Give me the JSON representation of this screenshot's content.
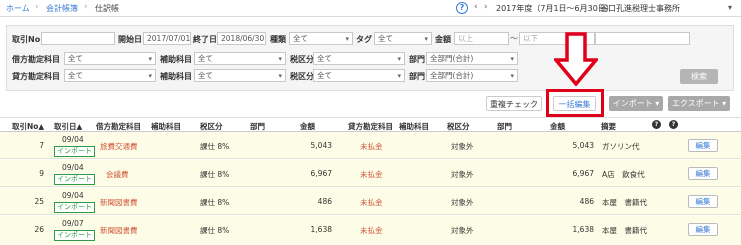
{
  "nav": {
    "home": "ホーム",
    "crumb1": "会計帳簿",
    "crumb2": "仕訳帳",
    "fiscal_year": "2017年度（7月1日〜6月30日）",
    "office": "谷口孔進税理士事務所"
  },
  "filters": {
    "id_label": "取引No",
    "start_label": "開始日",
    "start_value": "2017/07/01",
    "end_label": "終了日",
    "end_value": "2018/06/30",
    "type_label": "種類",
    "type_value": "全て",
    "tag_label": "タグ",
    "tag_value": "全て",
    "amount_label": "金額",
    "amount_min_ph": "以上",
    "amount_max_ph": "以下",
    "tilde": "〜",
    "debit_label": "借方勘定科目",
    "debit_value": "全て",
    "sub_label": "補助科目",
    "sub_value": "全て",
    "tax_label": "税区分",
    "tax_value": "全て",
    "dept_label": "部門",
    "dept_value": "全部門(合計)",
    "credit_label": "貸方勘定科目",
    "credit_value": "全て",
    "sub2_value": "全て",
    "tax2_value": "全て",
    "dept2_value": "全部門(合計)",
    "search": "検索"
  },
  "actions": {
    "dup_check": "重複チェック",
    "bulk_edit": "一括編集",
    "import": "インポート ▾",
    "export": "エクスポート ▾"
  },
  "table": {
    "headers": {
      "id": "取引No▲",
      "date": "取引日▲",
      "debit": "借方勘定科目",
      "sub": "補助科目",
      "tax": "税区分",
      "dept": "部門",
      "amount": "金額",
      "credit": "貸方勘定科目",
      "sub2": "補助科目",
      "tax2": "税区分",
      "dept2": "部門",
      "amount2": "金額",
      "memo": "摘要",
      "q": "?"
    },
    "rows": [
      {
        "id": "7",
        "date": "09/04",
        "badge": "インポート",
        "debit": "旅費交通費",
        "tax": "課仕 8%",
        "amount": "5,043",
        "credit": "未払金",
        "tax2": "対象外",
        "amount2": "5,043",
        "memo": "ガソリン代",
        "edit": "編集"
      },
      {
        "id": "9",
        "date": "09/04",
        "badge": "インポート",
        "debit": "会議費",
        "tax": "課仕 8%",
        "amount": "6,967",
        "credit": "未払金",
        "tax2": "対象外",
        "amount2": "6,967",
        "memo": "A店　飲食代",
        "edit": "編集"
      },
      {
        "id": "25",
        "date": "09/04",
        "badge": "インポート",
        "debit": "新聞図書費",
        "tax": "課仕 8%",
        "amount": "486",
        "credit": "未払金",
        "tax2": "対象外",
        "amount2": "486",
        "memo": "本屋　書籍代",
        "edit": "編集"
      },
      {
        "id": "26",
        "date": "09/07",
        "badge": "インポート",
        "debit": "新聞図書費",
        "tax": "課仕 8%",
        "amount": "1,638",
        "credit": "未払金",
        "tax2": "対象外",
        "amount2": "1,638",
        "memo": "本屋　書籍代",
        "edit": "編集"
      }
    ]
  }
}
